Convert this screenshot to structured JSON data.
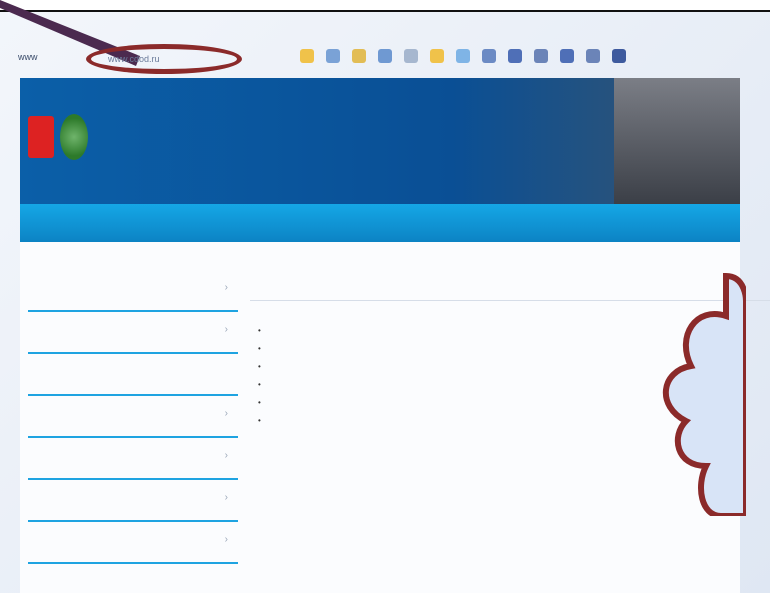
{
  "toolbar": {
    "left_label": "www",
    "address_text": "www.cdod.ru",
    "buttons": [
      "page",
      "back",
      "forward",
      "reload",
      "home",
      "print",
      "star",
      "search",
      "tools",
      "bookmark",
      "zoom-in",
      "zoom-out",
      "settings"
    ]
  },
  "banner": {
    "line1": "",
    "line2": "",
    "line3": "",
    "line4": ""
  },
  "nav": {
    "items": [
      "",
      "",
      "",
      "",
      "",
      ""
    ]
  },
  "sidebar": {
    "items": [
      {
        "label": "",
        "has_chevron": true
      },
      {
        "label": "",
        "has_chevron": true
      },
      {
        "label": "",
        "has_chevron": false
      },
      {
        "label": "",
        "has_chevron": true
      },
      {
        "label": "",
        "has_chevron": true
      },
      {
        "label": "",
        "has_chevron": true
      },
      {
        "label": "",
        "has_chevron": true
      }
    ]
  },
  "main": {
    "breadcrumb": "",
    "title": "",
    "subtitle": "",
    "list": [
      "",
      "",
      "",
      "",
      "",
      ""
    ]
  },
  "colors": {
    "banner": "#0b5fa8",
    "nav": "#15a7e6",
    "highlight_oval": "#8b2a2a",
    "sidebar_border": "#1ea3e1"
  }
}
